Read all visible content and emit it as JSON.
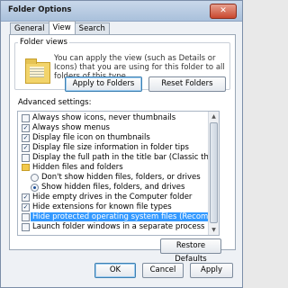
{
  "window": {
    "title": "Folder Options",
    "close_label": "✕"
  },
  "tabs": [
    {
      "label": "General",
      "active": false
    },
    {
      "label": "View",
      "active": true
    },
    {
      "label": "Search",
      "active": false
    }
  ],
  "folder_views": {
    "legend": "Folder views",
    "description": "You can apply the view (such as Details or Icons) that you are using for this folder to all folders of this type.",
    "apply_button": "Apply to Folders",
    "reset_button": "Reset Folders"
  },
  "advanced": {
    "label": "Advanced settings:",
    "items": [
      {
        "kind": "checkbox",
        "label": "Always show icons, never thumbnails",
        "checked": false
      },
      {
        "kind": "checkbox",
        "label": "Always show menus",
        "checked": true
      },
      {
        "kind": "checkbox",
        "label": "Display file icon on thumbnails",
        "checked": true
      },
      {
        "kind": "checkbox",
        "label": "Display file size information in folder tips",
        "checked": true
      },
      {
        "kind": "checkbox",
        "label": "Display the full path in the title bar (Classic theme only)",
        "checked": false
      },
      {
        "kind": "folder",
        "label": "Hidden files and folders"
      },
      {
        "kind": "radio",
        "label": "Don't show hidden files, folders, or drives",
        "checked": false
      },
      {
        "kind": "radio",
        "label": "Show hidden files, folders, and drives",
        "checked": true
      },
      {
        "kind": "checkbox",
        "label": "Hide empty drives in the Computer folder",
        "checked": true
      },
      {
        "kind": "checkbox",
        "label": "Hide extensions for known file types",
        "checked": true
      },
      {
        "kind": "checkbox",
        "label": "Hide protected operating system files (Recommended)",
        "checked": false,
        "selected": true
      },
      {
        "kind": "checkbox",
        "label": "Launch folder windows in a separate process",
        "checked": false
      }
    ],
    "restore_button": "Restore Defaults"
  },
  "footer": {
    "ok": "OK",
    "cancel": "Cancel",
    "apply": "Apply"
  },
  "check_glyph": "✓"
}
